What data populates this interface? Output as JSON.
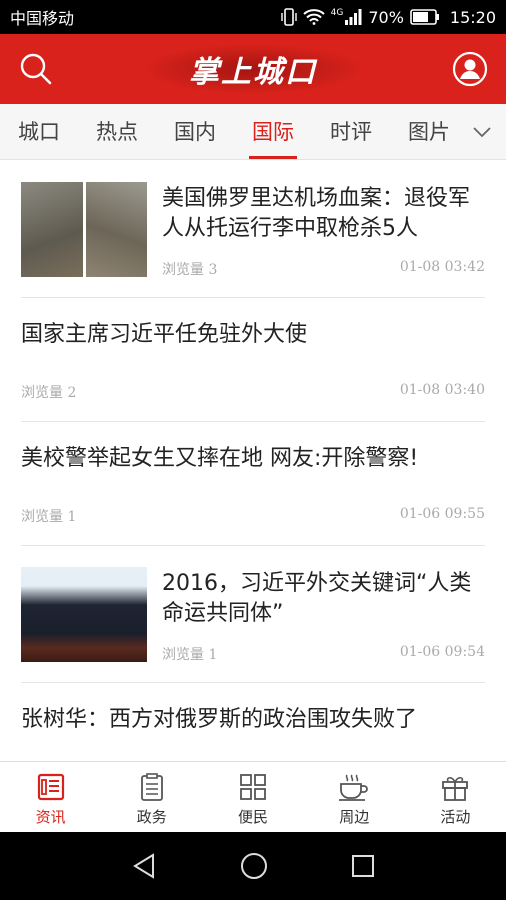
{
  "status": {
    "carrier": "中国移动",
    "network": "4G",
    "battery": "70%",
    "time": "15:20"
  },
  "app": {
    "title": "掌上城口",
    "accent": "#d8221b"
  },
  "tabs": [
    {
      "label": "城口"
    },
    {
      "label": "热点"
    },
    {
      "label": "国内"
    },
    {
      "label": "国际",
      "active": true
    },
    {
      "label": "时评"
    },
    {
      "label": "图片"
    }
  ],
  "news": [
    {
      "title": "美国佛罗里达机场血案：退役军人从托运行李中取枪杀5人",
      "views": "浏览量 3",
      "time": "01-08 03:42",
      "thumb": "airport-photos"
    },
    {
      "title": "国家主席习近平任免驻外大使",
      "views": "浏览量 2",
      "time": "01-08 03:40"
    },
    {
      "title": "美校警举起女生又摔在地 网友:开除警察!",
      "views": "浏览量 1",
      "time": "01-06 09:55"
    },
    {
      "title": "2016，习近平外交关键词“人类命运共同体”",
      "views": "浏览量 1",
      "time": "01-06 09:54",
      "thumb": "speech-photo"
    },
    {
      "title": "张树华：西方对俄罗斯的政治围攻失败了"
    }
  ],
  "bottom_nav": [
    {
      "label": "资讯",
      "icon": "news-icon",
      "active": true
    },
    {
      "label": "政务",
      "icon": "clipboard-icon"
    },
    {
      "label": "便民",
      "icon": "grid-icon"
    },
    {
      "label": "周边",
      "icon": "coffee-icon"
    },
    {
      "label": "活动",
      "icon": "gift-icon"
    }
  ]
}
